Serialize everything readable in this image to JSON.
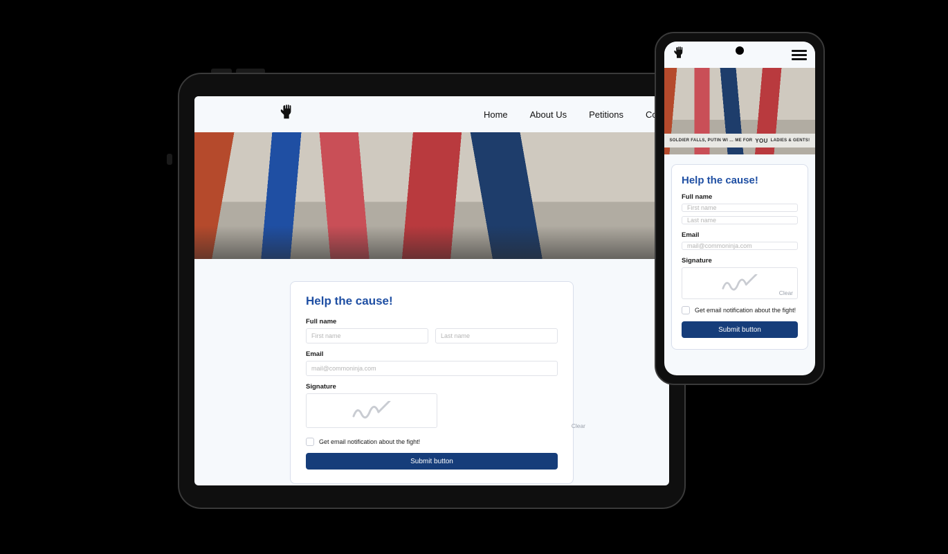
{
  "nav": {
    "items": [
      "Home",
      "About Us",
      "Petitions",
      "Contact"
    ]
  },
  "form": {
    "title": "Help the cause!",
    "full_name_label": "Full name",
    "first_name_placeholder": "First name",
    "last_name_placeholder": "Last name",
    "email_label": "Email",
    "email_placeholder": "mail@commoninja.com",
    "signature_label": "Signature",
    "clear_label": "Clear",
    "checkbox_label": "Get email notification about the fight!",
    "submit_label": "Submit button"
  },
  "phone_banner": {
    "text_before": "Soldier falls, Putin wi",
    "text_mid": "me for",
    "text_big": "YOU",
    "text_after": "Ladies & Gents!"
  }
}
